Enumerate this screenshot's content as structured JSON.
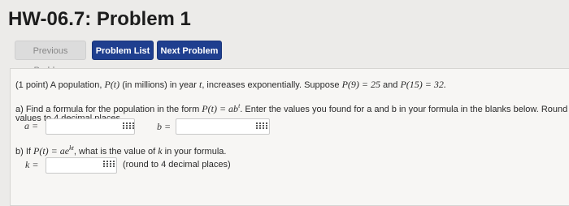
{
  "page": {
    "title": "HW-06.7: Problem 1"
  },
  "nav": {
    "previous_label": "Previous Problem",
    "list_label": "Problem List",
    "next_label": "Next Problem"
  },
  "problem": {
    "intro_prefix": "(1 point) A population,",
    "intro_pt": "P(t)",
    "intro_mid": "(in millions) in year",
    "intro_t": "t",
    "intro_rest": ", increases exponentially. Suppose",
    "intro_p9": "P(9) = 25",
    "intro_and": "and",
    "intro_p15": "P(15) = 32.",
    "part_a_prefix": "a) Find a formula for the population in the form",
    "part_a_form": "P(t) = ab",
    "part_a_form_exp": "t",
    "part_a_rest": ". Enter the values you found for a and b in your formula in the blanks below. Round your",
    "part_a_line2": "values to 4 decimal places.",
    "a_label": "a =",
    "b_label": "b =",
    "a_value": "",
    "b_value": "",
    "part_b_prefix": "b) If",
    "part_b_form": "P(t) = ae",
    "part_b_form_exp": "kt",
    "part_b_mid": ", what is the value of",
    "part_b_k": "k",
    "part_b_rest": "in your formula.",
    "k_label": "k =",
    "k_value": "",
    "k_note": "(round to 4 decimal places)"
  },
  "icons": {
    "answer_helper": "grid-icon"
  },
  "colors": {
    "primary_button": "#1f3f8f",
    "panel_bg": "#f7f6f4",
    "page_bg": "#ecebe9"
  }
}
